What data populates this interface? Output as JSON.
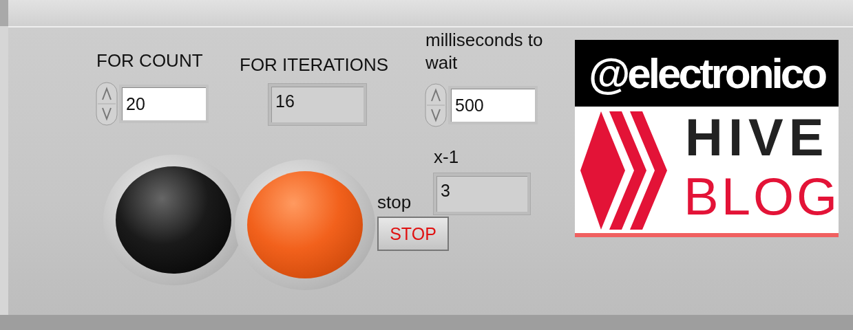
{
  "controls": [
    {
      "kind": "control",
      "label": "FOR COUNT",
      "value": "20"
    },
    {
      "kind": "indicator",
      "label": "FOR ITERATIONS",
      "value": "16"
    },
    {
      "kind": "control",
      "label": "milliseconds to wait",
      "value": "500"
    },
    {
      "kind": "indicator",
      "label": "x-1",
      "value": "3"
    }
  ],
  "leds": [
    {
      "on": false
    },
    {
      "on": true
    }
  ],
  "stop_button": {
    "label": "stop",
    "caption": "STOP"
  },
  "logo": {
    "handle": "@electronico",
    "line_1": "HIVE",
    "line_2": "BLOG"
  }
}
